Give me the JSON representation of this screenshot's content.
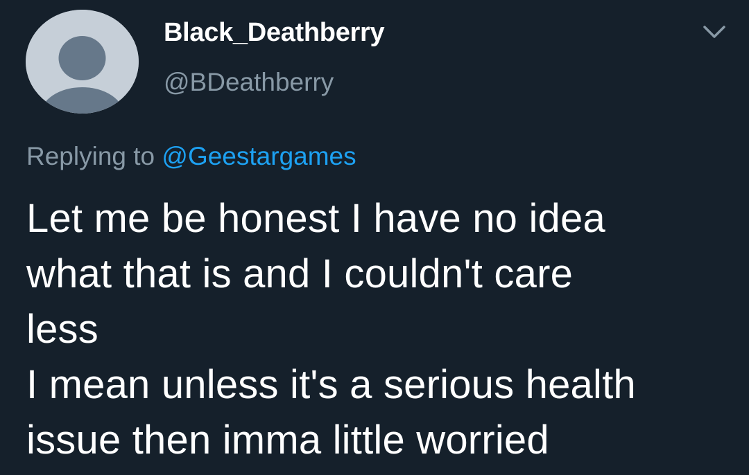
{
  "user": {
    "display_name": "Black_Deathberry",
    "handle": "@BDeathberry",
    "avatar_icon": "default-profile-avatar-icon"
  },
  "header": {
    "menu_icon": "chevron-down-icon"
  },
  "reply": {
    "prefix": "Replying to ",
    "mention": "@Geestargames"
  },
  "tweet": {
    "text": "Let me be honest I have no idea\nwhat that is and I couldn't care\nless\n I mean unless it's a serious health\nissue then imma little worried"
  },
  "colors": {
    "background": "#15202b",
    "text_primary": "#ffffff",
    "text_secondary": "#8899a6",
    "link": "#1da1f2",
    "avatar_bg": "#c6cfd8",
    "avatar_figure": "#66788a"
  }
}
